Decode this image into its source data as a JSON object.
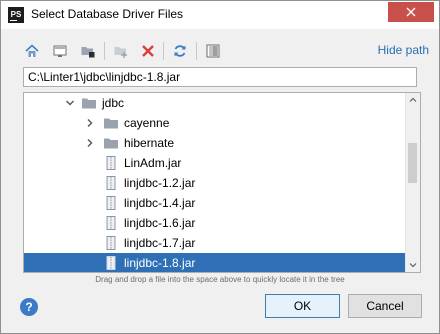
{
  "window": {
    "title": "Select Database Driver Files",
    "app_icon_text": "PS"
  },
  "toolbar": {
    "hide_path_label": "Hide path",
    "icons": [
      "home-icon",
      "desktop-icon",
      "project-folder-icon",
      "new-folder-icon",
      "delete-icon",
      "refresh-icon",
      "show-hidden-icon"
    ]
  },
  "path": {
    "value": "C:\\Linter1\\jdbc\\linjdbc-1.8.jar"
  },
  "tree": {
    "items": [
      {
        "label": "jdbc",
        "type": "folder",
        "expanded": true
      },
      {
        "label": "cayenne",
        "type": "folder",
        "expanded": false
      },
      {
        "label": "hibernate",
        "type": "folder",
        "expanded": false
      },
      {
        "label": "LinAdm.jar",
        "type": "jar"
      },
      {
        "label": "linjdbc-1.2.jar",
        "type": "jar"
      },
      {
        "label": "linjdbc-1.4.jar",
        "type": "jar"
      },
      {
        "label": "linjdbc-1.6.jar",
        "type": "jar"
      },
      {
        "label": "linjdbc-1.7.jar",
        "type": "jar"
      },
      {
        "label": "linjdbc-1.8.jar",
        "type": "jar",
        "selected": true
      }
    ]
  },
  "hint": "Drag and drop a file into the space above to quickly locate it in the tree",
  "buttons": {
    "help": "?",
    "ok": "OK",
    "cancel": "Cancel"
  },
  "colors": {
    "selection": "#2f6fb5",
    "link": "#2470b3",
    "close": "#c7504a"
  }
}
